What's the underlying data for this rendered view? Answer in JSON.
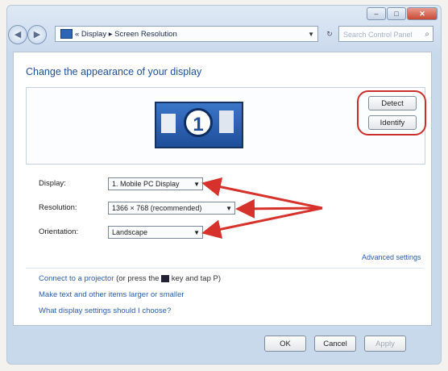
{
  "window": {
    "controls": {
      "minimize": "–",
      "maximize": "□",
      "close": "✕"
    }
  },
  "nav": {
    "back_icon": "back-arrow-icon",
    "forward_icon": "forward-arrow-icon",
    "breadcrumb": "« Display ▸ Screen Resolution",
    "search_placeholder": "Search Control Panel"
  },
  "main": {
    "heading": "Change the appearance of your display",
    "monitor_number": "1",
    "detect_label": "Detect",
    "identify_label": "Identify"
  },
  "settings": {
    "display_label": "Display:",
    "display_value": "1. Mobile PC Display",
    "resolution_label": "Resolution:",
    "resolution_value": "1366 × 768 (recommended)",
    "orientation_label": "Orientation:",
    "orientation_value": "Landscape",
    "advanced_link": "Advanced settings"
  },
  "links": {
    "projector_link": "Connect to a projector",
    "projector_hint_pre": "(or press the",
    "projector_hint_post": "key and tap P)",
    "text_size_link": "Make text and other items larger or smaller",
    "help_link": "What display settings should I choose?"
  },
  "footer": {
    "ok": "OK",
    "cancel": "Cancel",
    "apply": "Apply"
  },
  "colors": {
    "annotation": "#d6312a",
    "link": "#2a5db0",
    "heading": "#1f4f9a"
  }
}
